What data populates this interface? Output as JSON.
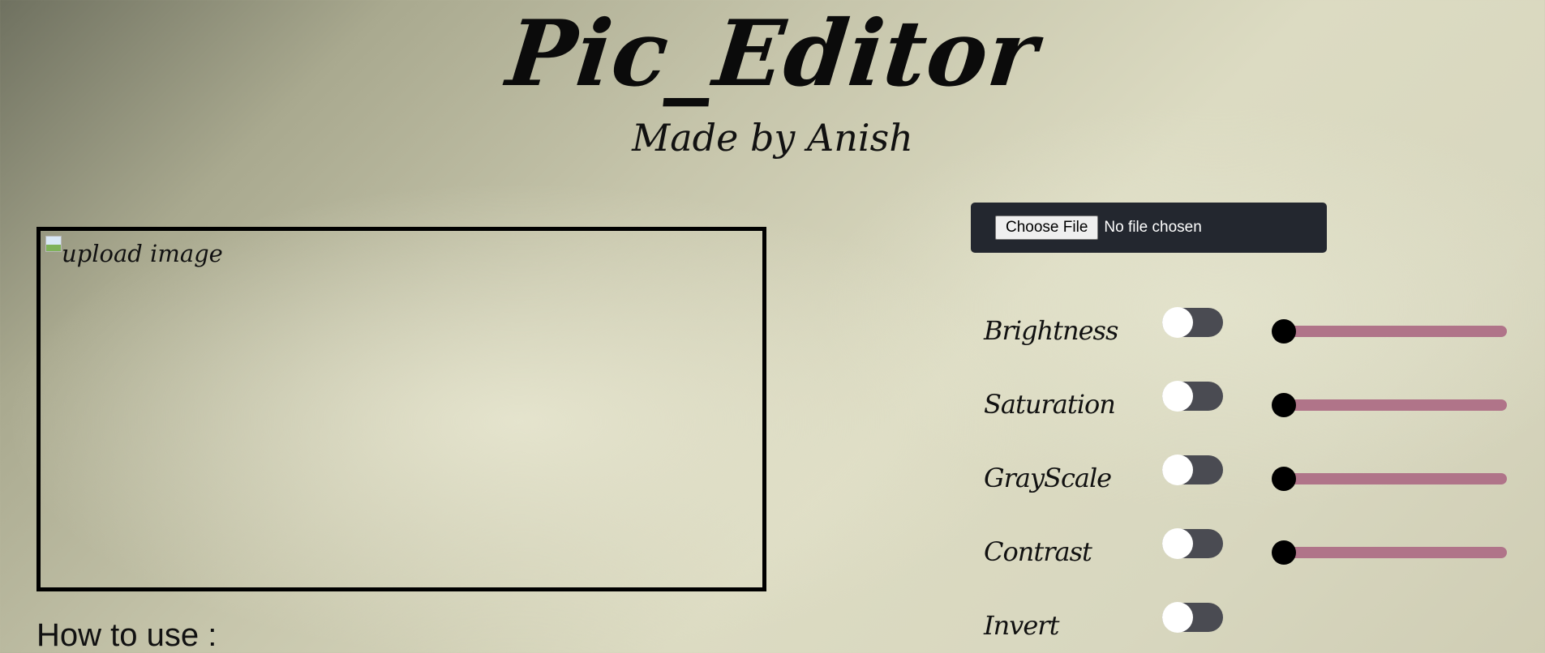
{
  "header": {
    "title": "Pic_Editor",
    "subtitle": "Made by Anish"
  },
  "preview": {
    "image_alt": "upload image"
  },
  "instructions": {
    "heading": "How to use :"
  },
  "file_input": {
    "button_label": "Choose File",
    "status": "No file chosen"
  },
  "controls": [
    {
      "label": "Brightness",
      "toggle_on": false,
      "has_slider": true,
      "slider_value": 0
    },
    {
      "label": "Saturation",
      "toggle_on": false,
      "has_slider": true,
      "slider_value": 0
    },
    {
      "label": "GrayScale",
      "toggle_on": false,
      "has_slider": true,
      "slider_value": 0
    },
    {
      "label": "Contrast",
      "toggle_on": false,
      "has_slider": true,
      "slider_value": 0
    },
    {
      "label": "Invert",
      "toggle_on": false,
      "has_slider": false
    }
  ],
  "colors": {
    "file_panel_bg": "#23272f",
    "toggle_off_bg": "#4a4b52",
    "slider_track": "#b07489",
    "slider_thumb": "#000000"
  }
}
